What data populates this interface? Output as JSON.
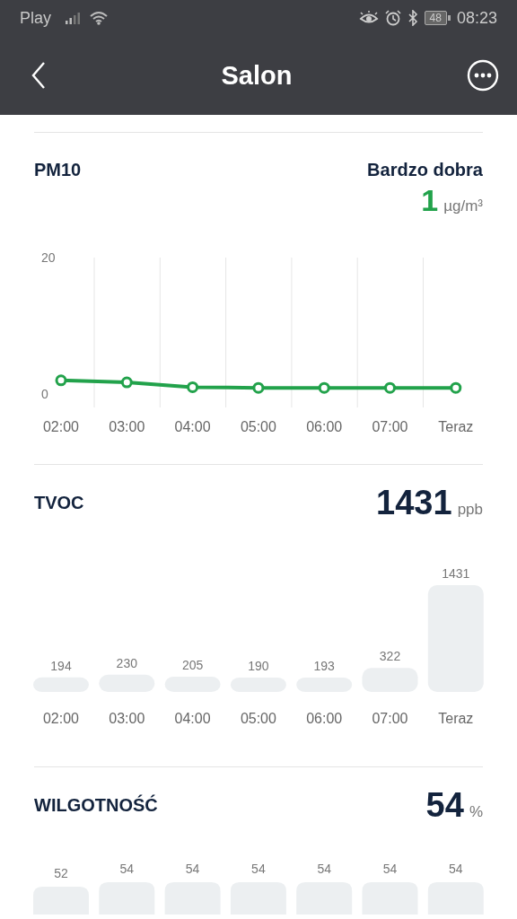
{
  "status_bar": {
    "carrier": "Play",
    "battery": "48",
    "time": "08:23"
  },
  "header": {
    "title": "Salon"
  },
  "sections": [
    {
      "kind": "line",
      "title": "PM10",
      "rating": "Bardzo dobra",
      "value": "1",
      "unit": "µg/m³",
      "chart_data": {
        "type": "line",
        "categories": [
          "02:00",
          "03:00",
          "04:00",
          "05:00",
          "06:00",
          "07:00",
          "Teraz"
        ],
        "series": [
          {
            "color": "#22a24b",
            "marker": true,
            "values": [
              2,
              1.7,
              1,
              0.9,
              0.9,
              0.9,
              0.9
            ]
          }
        ],
        "ylim": [
          0,
          20
        ],
        "yticks": [
          0,
          20
        ]
      }
    },
    {
      "kind": "bar",
      "title": "TVOC",
      "value": "1431",
      "unit": "ppb",
      "chart_data": {
        "type": "bar",
        "categories": [
          "02:00",
          "03:00",
          "04:00",
          "05:00",
          "06:00",
          "07:00",
          "Teraz"
        ],
        "values": [
          194,
          230,
          205,
          190,
          193,
          322,
          1431
        ],
        "data_labels": true
      }
    },
    {
      "kind": "bar",
      "title": "WILGOTNOŚĆ",
      "value": "54",
      "unit": "%",
      "readings": [
        "52",
        "54",
        "54",
        "54",
        "54",
        "54",
        "54"
      ]
    }
  ]
}
